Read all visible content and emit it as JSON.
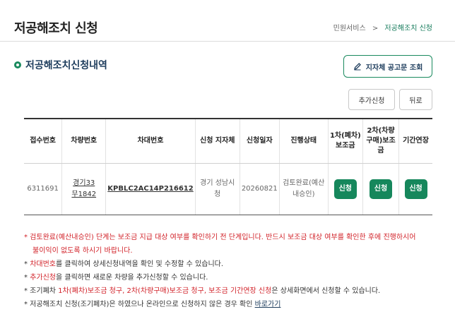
{
  "header": {
    "title": "저공해조치 신청",
    "breadcrumb": [
      "민원서비스",
      "저공해조치 신청"
    ],
    "breadcrumb_sep": ">"
  },
  "section": {
    "title": "저공해조치신청내역",
    "notice_button": "지자체 공고문 조회"
  },
  "actions": {
    "add_label": "추가신청",
    "back_label": "뒤로"
  },
  "table": {
    "headers": [
      "접수번호",
      "차량번호",
      "차대번호",
      "신청 지자체",
      "신청일자",
      "진행상태",
      "1차(폐차)보조금",
      "2차(차량구매)보조금",
      "기간연장"
    ],
    "rows": [
      {
        "receipt_no": "6311691",
        "plate_line1": "경기33",
        "plate_line2": "무1842",
        "vin": "KPBLC2AC14P216612",
        "region": "경기 성남시청",
        "date": "20260821",
        "status": "검토완료(예산내승인)",
        "apply1": "신청",
        "apply2": "신청",
        "apply3": "신청"
      }
    ]
  },
  "notes": {
    "n1_line1": "* 검토완료(예산내승인) 단계는 보조금 지급 대상 여부를 확인하기 전 단계입니다. 반드시 보조금 대상 여부를 확인한 후에 진행하시어",
    "n1_line2": "불이익이 없도록 하시기 바랍니다.",
    "n2_prefix": "* ",
    "n2_em": "차대번호",
    "n2_rest": "를 클릭하여 상세신청내역을 확인 및 수정할 수 있습니다.",
    "n3_prefix": "* ",
    "n3_em": "추가신청",
    "n3_rest": "을 클릭하면 새로운 차량을 추가신청할 수 있습니다.",
    "n4_a": "* 조기폐차 ",
    "n4_b": "1차(폐차)보조금 청구, 2차(차량구매)보조금 청구, 보조금 기간연장 신청",
    "n4_c": "은 상세화면에서 신청할 수 있습니다.",
    "n5_text": "* 저공해조치 신청(조기폐차)은 하였으나 온라인으로 신청하지 않은 경우 확인 ",
    "n5_link": "바로가기"
  },
  "colors": {
    "accent": "#16875c",
    "warning": "#d2232a",
    "title": "#1d3c5c"
  }
}
